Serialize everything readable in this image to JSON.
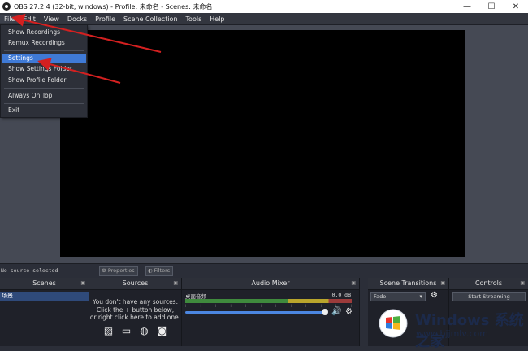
{
  "titlebar": {
    "title": "OBS 27.2.4 (32-bit, windows) - Profile: 未命名 - Scenes: 未命名",
    "minimize": "—",
    "maximize": "☐",
    "close": "✕"
  },
  "menubar": {
    "items": [
      "File",
      "Edit",
      "View",
      "Docks",
      "Profile",
      "Scene Collection",
      "Tools",
      "Help"
    ]
  },
  "file_menu": {
    "items": [
      "Show Recordings",
      "Remux Recordings",
      "Settings",
      "Show Settings Folder",
      "Show Profile Folder",
      "Always On Top",
      "Exit"
    ],
    "highlighted": "Settings"
  },
  "source_toolbar": {
    "status": "No source selected",
    "properties": "Properties",
    "filters": "Filters"
  },
  "docks": {
    "scenes": {
      "title": "Scenes",
      "items": [
        "场景"
      ]
    },
    "sources": {
      "title": "Sources",
      "empty_line1": "You don't have any sources.",
      "empty_line2": "Click the + button below,",
      "empty_line3": "or right click here to add one."
    },
    "mixer": {
      "title": "Audio Mixer",
      "channel": "桌面音频",
      "level": "0.0 dB"
    },
    "transitions": {
      "title": "Scene Transitions",
      "selected": "Fade"
    },
    "controls": {
      "title": "Controls",
      "start_streaming": "Start Streaming"
    }
  },
  "watermark": {
    "brand": "Windows 系统之家",
    "url": "www.bjjmlv.com"
  },
  "colors": {
    "highlight": "#3f7ad6",
    "annotation_arrow": "#d42020"
  }
}
